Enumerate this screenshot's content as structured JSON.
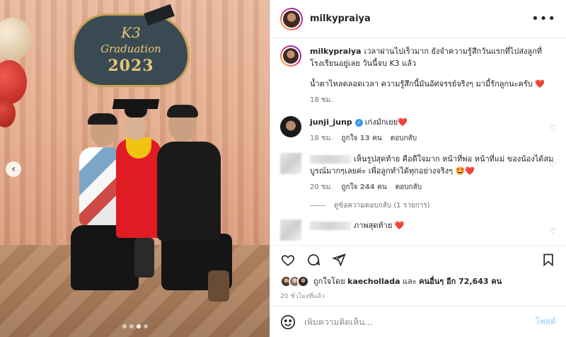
{
  "post": {
    "username": "milkypraiya",
    "caption_username": "milkypraiya",
    "caption_text": "เวลาผ่านไปเร็วมาก ยังจำความรู้สึกวันแรกที่ไปส่งลูกที่โรงเรียนอยู่เลย วันนี้จบ K3 แล้ว",
    "caption_text2": "น้ำตาไหลตลอดเวลา ความรู้สึกนี้มันอัศจรรย์จริงๆ มามี้รักลูกนะครับ",
    "caption_emoji": "❤️",
    "caption_time": "18 ชม.",
    "more_icon": "•••"
  },
  "media": {
    "sign_k3": "K3",
    "sign_graduation": "Graduation",
    "sign_year": "2023",
    "prev_arrow": "‹"
  },
  "comments": [
    {
      "username": "junji_junp",
      "verified": "✓",
      "text": "เก่งมักเยย",
      "emoji": "❤️",
      "time": "18 ชม.",
      "likes": "ถูกใจ 13 คน",
      "reply": "ตอบกลับ"
    },
    {
      "text": "เห็นรูปสุดท้าย คือดีใจมาก หน้าที่พ่อ หน้าที่แม่ ของน้องได้สมบูรณ์มากๆเลยค่ะ เพื่อลูกทำได้ทุกอย่างจริงๆ",
      "emoji": "🤩❤️",
      "time": "20 ชม.",
      "likes": "ถูกใจ 244 คน",
      "reply": "ตอบกลับ",
      "view_replies": "ดูข้อความตอบกลับ (1 รายการ)"
    },
    {
      "text": "ภาพสุดท้าย",
      "emoji": "❤️"
    }
  ],
  "likes_summary": {
    "prefix": "ถูกใจโดย",
    "user": "kaechollada",
    "mid": "และ",
    "others": "คนอื่นๆ อีก 72,643 คน"
  },
  "time_ago": "20 ชั่วโมงที่แล้ว",
  "add_comment": {
    "placeholder": "เพิ่มความคิดเห็น...",
    "post_label": "โพสต์"
  },
  "icons": {
    "heart": "heart-icon",
    "comment": "comment-icon",
    "share": "share-icon",
    "bookmark": "bookmark-icon",
    "emoji": "emoji-icon"
  },
  "colors": {
    "link_blue": "#b2dffc",
    "heart_red": "#ed4956",
    "verified_blue": "#3897f0"
  }
}
